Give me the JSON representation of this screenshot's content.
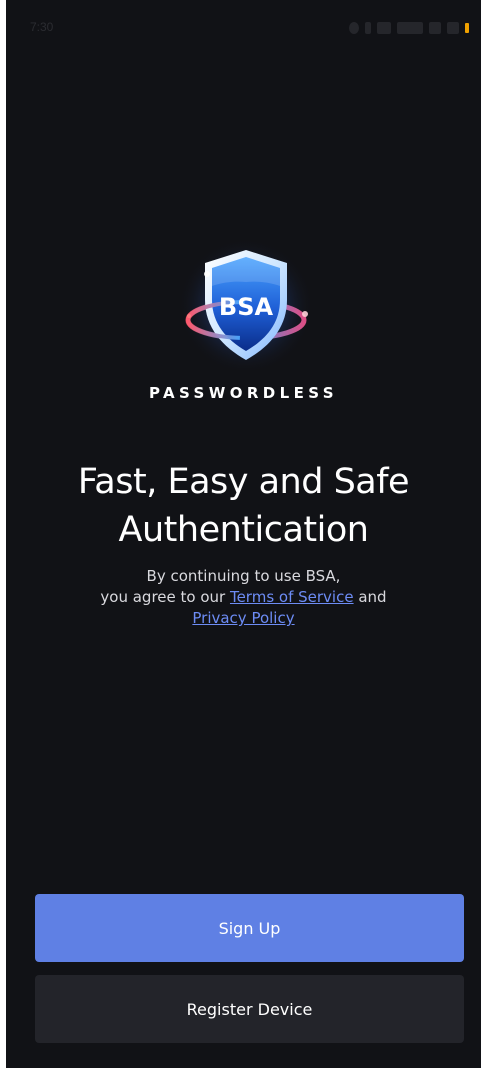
{
  "status_bar": {
    "time": "7:30"
  },
  "brand": {
    "shield_label": "BSA",
    "wordmark": "PASSWORDLESS"
  },
  "hero": {
    "title_line1": "Fast, Easy and Safe",
    "title_line2": "Authentication"
  },
  "consent": {
    "line1": "By continuing to use BSA,",
    "line2_prefix": "you agree to our ",
    "terms_link": "Terms of Service",
    "line2_suffix": " and",
    "privacy_link": "Privacy Policy"
  },
  "actions": {
    "sign_up_label": "Sign Up",
    "register_label": "Register Device"
  },
  "colors": {
    "background": "#111216",
    "primary_button": "#5f80e4",
    "secondary_button": "#23242a",
    "link": "#6d8cf5",
    "battery": "#f0a100"
  }
}
